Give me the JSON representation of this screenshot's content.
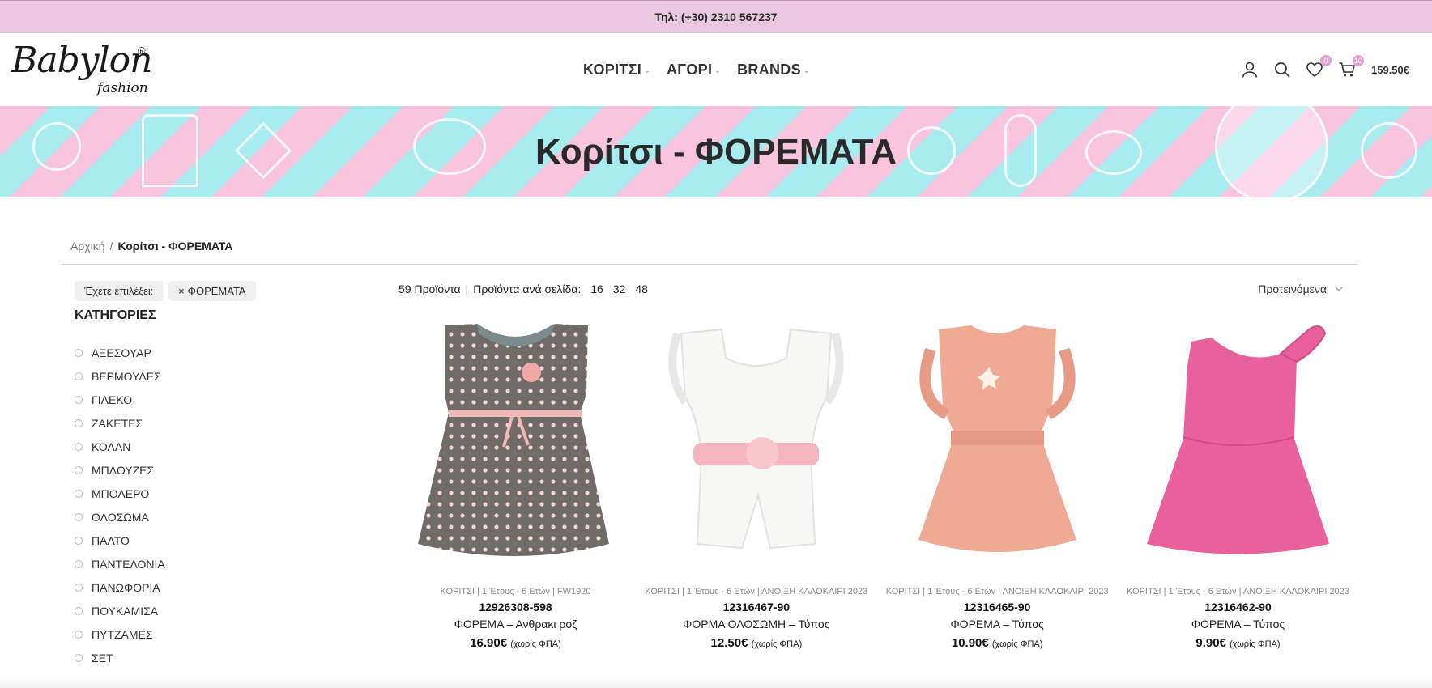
{
  "topbar": {
    "phone": "Τηλ: (+30) 2310 567237"
  },
  "logo": {
    "main": "Babylon",
    "sub": "fashion",
    "reg": "®"
  },
  "nav": [
    {
      "label": "ΚΟΡΙΤΣΙ"
    },
    {
      "label": "ΑΓΟΡΙ"
    },
    {
      "label": "BRANDS"
    }
  ],
  "header_icons": {
    "wishlist_count": "0",
    "cart_count": "10",
    "cart_total": "159.50€"
  },
  "banner": {
    "title": "Κορίτσι - ΦΟΡΕΜΑΤΑ"
  },
  "breadcrumb": {
    "home": "Αρχική",
    "separator": "/",
    "current": "Κορίτσι - ΦΟΡΕΜΑΤΑ"
  },
  "filters": {
    "selected_label": "Έχετε επιλέξει:",
    "chip": "ΦΟΡΕΜΑΤΑ",
    "chip_icon": "close-icon"
  },
  "sidebar": {
    "title": "ΚΑΤΗΓΟΡΙΕΣ",
    "categories": [
      "ΑΞΕΣΟΥΑΡ",
      "ΒΕΡΜΟΥΔΕΣ",
      "ΓΙΛΕΚΟ",
      "ΖΑΚΕΤΕΣ",
      "ΚΟΛΑΝ",
      "ΜΠΛΟΥΖΕΣ",
      "ΜΠΟΛΕΡΟ",
      "ΟΛΟΣΩΜΑ",
      "ΠΑΛΤΟ",
      "ΠΑΝΤΕΛΟΝΙΑ",
      "ΠΑΝΩΦΟΡΙΑ",
      "ΠΟΥΚΑΜΙΣΑ",
      "ΠΥΤΖΑΜΕΣ",
      "ΣΕΤ"
    ]
  },
  "toolbar": {
    "count": "59 Προϊόντα",
    "separator": "|",
    "per_page_label": "Προϊόντα ανά σελίδα:",
    "per_page_options": [
      "16",
      "32",
      "48"
    ],
    "sort": "Προτεινόμενα"
  },
  "products": [
    {
      "meta": "ΚΟΡΙΤΣΙ | 1 Έτους - 6 Ετών | FW1920",
      "sku": "12926308-598",
      "name": "ΦΟΡΕΜΑ – Ανθρακι ροζ",
      "price": "16.90€",
      "vat": "(χωρίς ΦΠΑ)"
    },
    {
      "meta": "ΚΟΡΙΤΣΙ | 1 Έτους - 6 Ετών | ΑΝΟΙΞΗ ΚΑΛΟΚΑΙΡΙ 2023",
      "sku": "12316467-90",
      "name": "ΦΟΡΜΑ ΟΛΟΣΩΜΗ – Τύπος",
      "price": "12.50€",
      "vat": "(χωρίς ΦΠΑ)"
    },
    {
      "meta": "ΚΟΡΙΤΣΙ | 1 Έτους - 6 Ετών | ΑΝΟΙΞΗ ΚΑΛΟΚΑΙΡΙ 2023",
      "sku": "12316465-90",
      "name": "ΦΟΡΕΜΑ – Τύπος",
      "price": "10.90€",
      "vat": "(χωρίς ΦΠΑ)"
    },
    {
      "meta": "ΚΟΡΙΤΣΙ | 1 Έτους - 6 Ετών | ΑΝΟΙΞΗ ΚΑΛΟΚΑΙΡΙ 2023",
      "sku": "12316462-90",
      "name": "ΦΟΡΕΜΑ – Τύπος",
      "price": "9.90€",
      "vat": "(χωρίς ΦΠΑ)"
    }
  ],
  "colors": {
    "topbar_bg": "#e7c8df",
    "banner_pink": "#f9c4de",
    "banner_cyan": "#a9ecef",
    "badge": "#e2a3d0",
    "dress1": "#6f6b69",
    "dress2": "#f7f7f5",
    "dress3": "#eeaa95",
    "dress4": "#e9609c"
  }
}
